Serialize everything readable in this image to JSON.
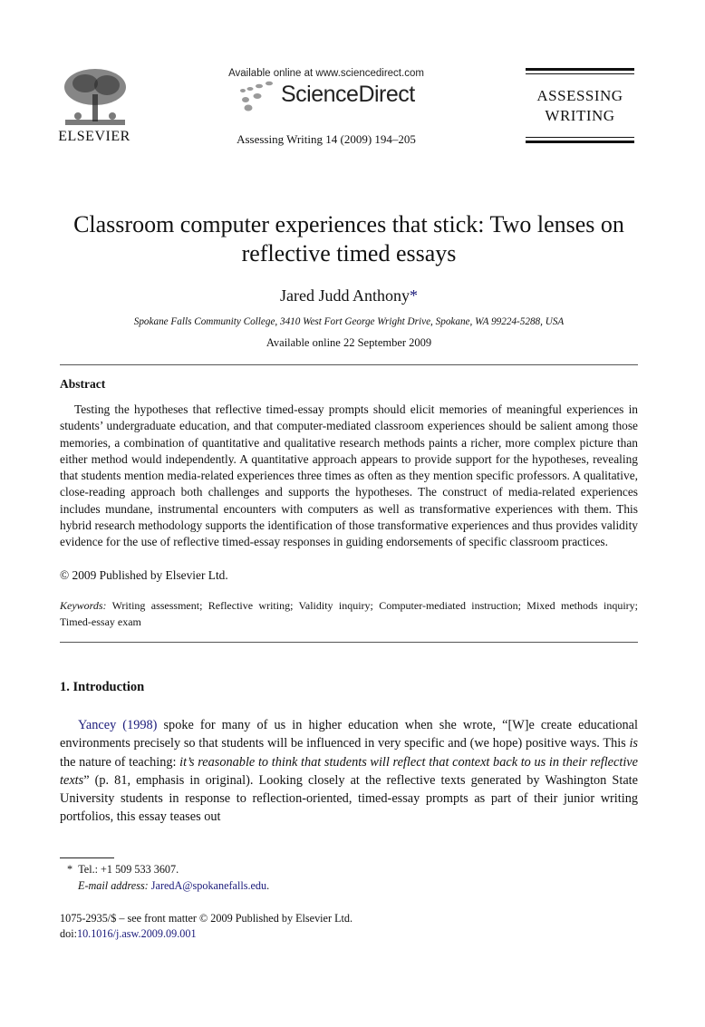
{
  "header": {
    "publisher": "ELSEVIER",
    "available_online_text": "Available online at www.sciencedirect.com",
    "platform_name": "ScienceDirect",
    "journal_reference": "Assessing Writing 14 (2009) 194–205",
    "journal_logo_line1": "ASSESSING",
    "journal_logo_line2": "WRITING"
  },
  "article": {
    "title": "Classroom computer experiences that stick: Two lenses on reflective timed essays",
    "author": "Jared Judd Anthony",
    "author_mark": "*",
    "affiliation": "Spokane Falls Community College, 3410 West Fort George Wright Drive, Spokane, WA 99224-5288, USA",
    "available_online": "Available online 22 September 2009"
  },
  "abstract": {
    "heading": "Abstract",
    "text": "Testing the hypotheses that reflective timed-essay prompts should elicit memories of meaningful experiences in students’ undergraduate education, and that computer-mediated classroom experiences should be salient among those memories, a combination of quantitative and qualitative research methods paints a richer, more complex picture than either method would independently. A quantitative approach appears to provide support for the hypotheses, revealing that students mention media-related experiences three times as often as they mention specific professors. A qualitative, close-reading approach both challenges and supports the hypotheses. The construct of media-related experiences includes mundane, instrumental encounters with computers as well as transformative experiences with them. This hybrid research methodology supports the identification of those transformative experiences and thus provides validity evidence for the use of reflective timed-essay responses in guiding endorsements of specific classroom practices.",
    "copyright": "© 2009 Published by Elsevier Ltd."
  },
  "keywords": {
    "label": "Keywords:",
    "text": "Writing assessment; Reflective writing; Validity inquiry; Computer-mediated instruction; Mixed methods inquiry; Timed-essay exam"
  },
  "section1": {
    "heading": "1.  Introduction",
    "citation_link": "Yancey (1998)",
    "seg1": " spoke for many of us in higher education when she wrote, “[W]e create educational environments precisely so that students will be influenced in very specific and (we hope) positive ways. This ",
    "seg2_italic": "is",
    "seg3": " the nature of teaching: ",
    "seg4_italic": "it’s reasonable to think that students will reflect that context back to us in their reflective texts",
    "seg5": "” (p. 81, emphasis in original). Looking closely at the reflective texts generated by Washington State University students in response to reflection-oriented, timed-essay prompts as part of their junior writing portfolios, this essay teases out"
  },
  "footnotes": {
    "mark": "*",
    "tel": "Tel.: +1 509 533 3607.",
    "email_label": "E-mail address:",
    "email": "JaredA@spokanefalls.edu",
    "email_end": "."
  },
  "front_matter": {
    "issn_line": "1075-2935/$ – see front matter © 2009 Published by Elsevier Ltd.",
    "doi_prefix": "doi:",
    "doi": "10.1016/j.asw.2009.09.001"
  },
  "colors": {
    "link": "#1a1a7a",
    "text": "#111111"
  }
}
